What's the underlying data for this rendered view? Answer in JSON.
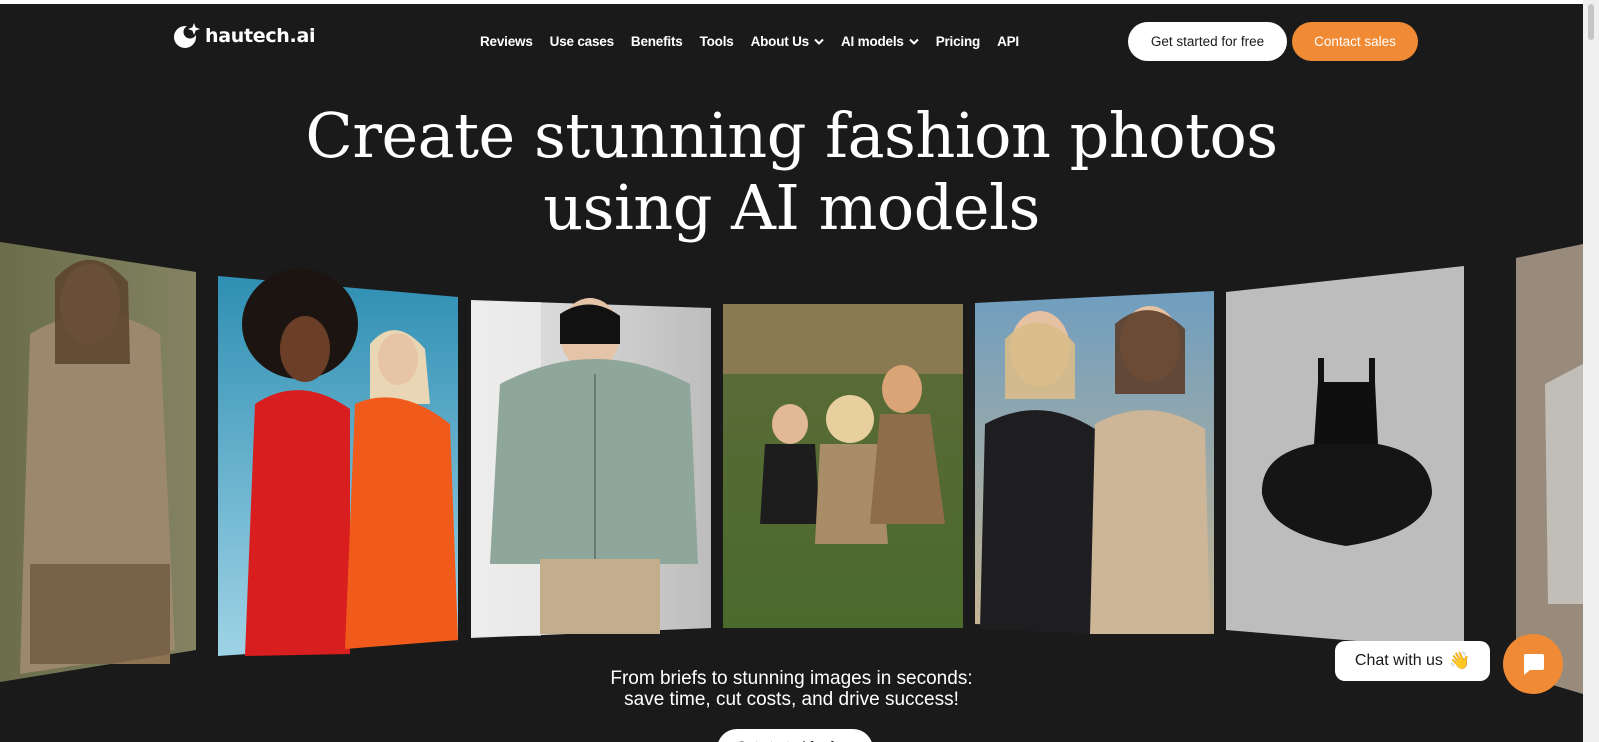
{
  "brand": {
    "name": "hautech.ai"
  },
  "nav": {
    "items": [
      {
        "label": "Reviews",
        "dropdown": false
      },
      {
        "label": "Use cases",
        "dropdown": false
      },
      {
        "label": "Benefits",
        "dropdown": false
      },
      {
        "label": "Tools",
        "dropdown": false
      },
      {
        "label": "About Us",
        "dropdown": true
      },
      {
        "label": "AI models",
        "dropdown": true
      },
      {
        "label": "Pricing",
        "dropdown": false
      },
      {
        "label": "API",
        "dropdown": false
      }
    ]
  },
  "header": {
    "primary_cta": "Get started for free",
    "secondary_cta": "Contact sales"
  },
  "hero": {
    "title_line1": "Create stunning fashion photos",
    "title_line2": "using AI models",
    "subtitle_line1": "From briefs to stunning images in seconds:",
    "subtitle_line2": "save time, cut costs, and drive success!",
    "cta_label": "Get started for free"
  },
  "gallery": {
    "images": [
      "woman-beige-shirt",
      "two-models-red-orange-dresses",
      "green-puffer-jacket",
      "kids-running-in-coats",
      "two-women-suits",
      "black-tutu-dress",
      "woman-white-outfit"
    ]
  },
  "chat": {
    "bubble_label": "Chat with us",
    "wave_emoji": "👋",
    "icon": "chat-icon"
  },
  "colors": {
    "background": "#1a1a1a",
    "accent": "#f08a35",
    "text": "#ffffff"
  }
}
